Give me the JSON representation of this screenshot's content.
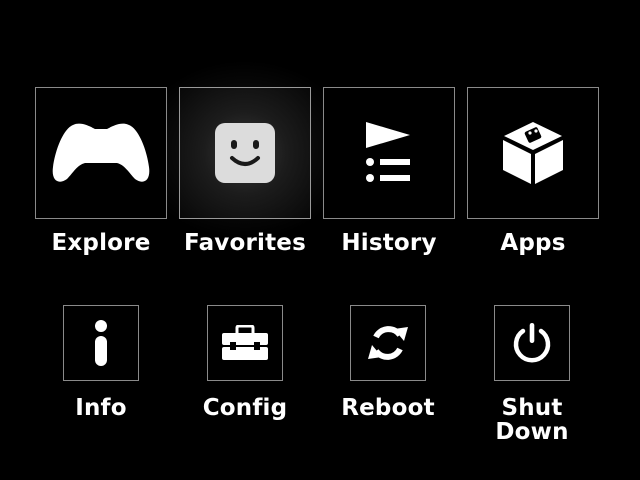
{
  "menu": {
    "top_row": [
      {
        "label": "Explore",
        "icon": "gamepad-icon"
      },
      {
        "label": "Favorites",
        "icon": "smiley-face-icon",
        "selected": true
      },
      {
        "label": "History",
        "icon": "playlist-icon"
      },
      {
        "label": "Apps",
        "icon": "app-box-icon"
      }
    ],
    "bottom_row": [
      {
        "label": "Info",
        "icon": "info-icon"
      },
      {
        "label": "Config",
        "icon": "toolbox-icon"
      },
      {
        "label": "Reboot",
        "icon": "refresh-icon"
      },
      {
        "label": "Shut\nDown",
        "icon": "power-icon"
      }
    ]
  },
  "colors": {
    "background": "#000000",
    "tile_border": "#8a8a8a",
    "icon": "#ffffff",
    "selected_icon_fill": "#dcdcdc"
  }
}
